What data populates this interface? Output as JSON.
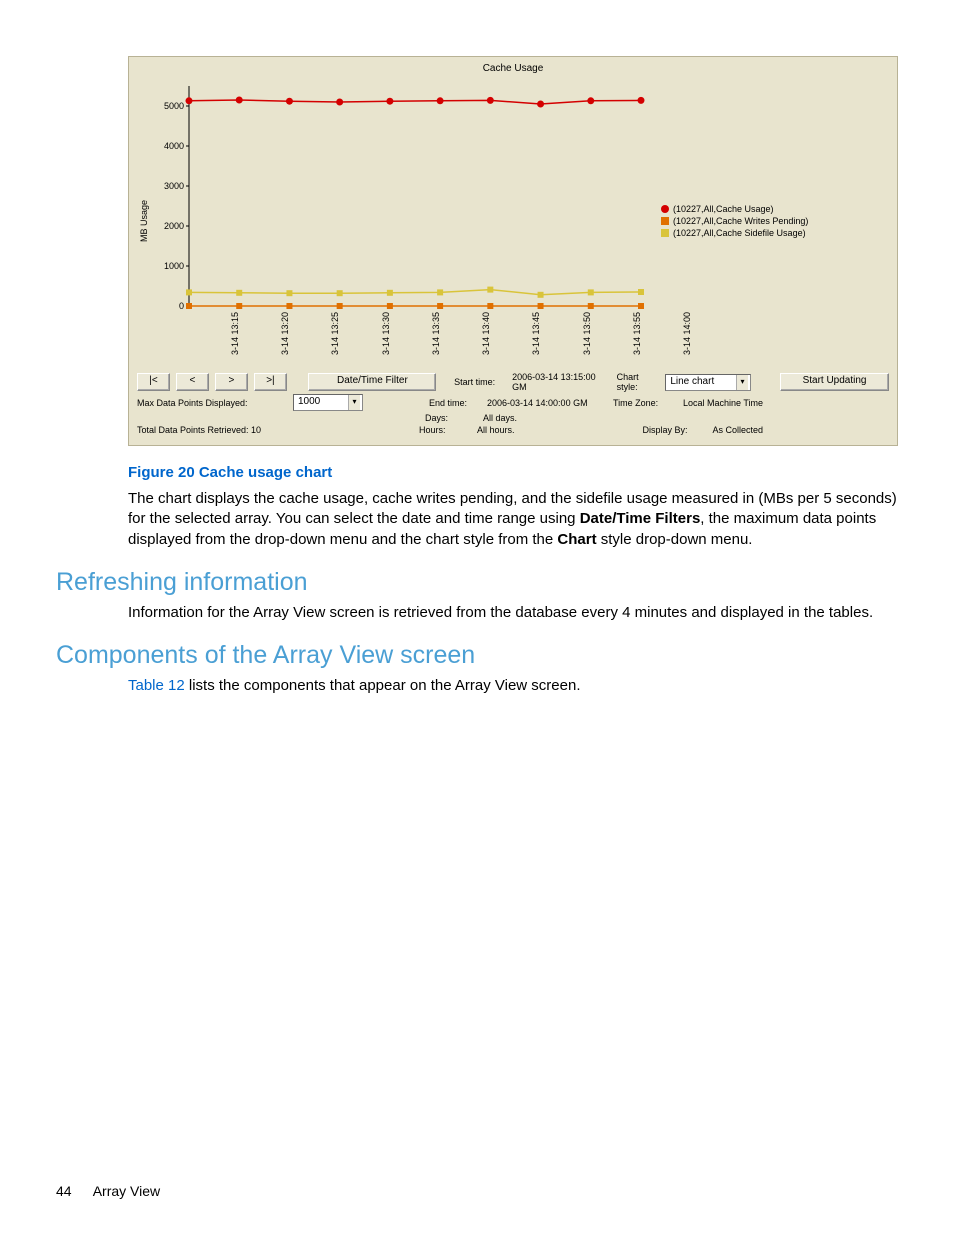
{
  "chart_data": {
    "type": "line",
    "title": "Cache Usage",
    "ylabel": "MB Usage",
    "ylim": [
      0,
      5500
    ],
    "yticks": [
      "0",
      "1000",
      "2000",
      "3000",
      "4000",
      "5000"
    ],
    "categories": [
      "3-14 13:15",
      "3-14 13:20",
      "3-14 13:25",
      "3-14 13:30",
      "3-14 13:35",
      "3-14 13:40",
      "3-14 13:45",
      "3-14 13:50",
      "3-14 13:55",
      "3-14 14:00"
    ],
    "series": [
      {
        "name": "(10227,All,Cache Usage)",
        "color": "#d40000",
        "marker": "circle",
        "values": [
          5130,
          5150,
          5120,
          5100,
          5120,
          5130,
          5140,
          5050,
          5130,
          5140
        ]
      },
      {
        "name": "(10227,All,Cache Writes Pending)",
        "color": "#e07000",
        "marker": "square",
        "values": [
          0,
          0,
          0,
          0,
          0,
          0,
          0,
          0,
          0,
          0
        ]
      },
      {
        "name": "(10227,All,Cache Sidefile Usage)",
        "color": "#d9c43a",
        "marker": "square",
        "values": [
          340,
          330,
          320,
          320,
          330,
          340,
          410,
          280,
          340,
          350
        ]
      }
    ]
  },
  "controls": {
    "nav_first": "|<",
    "nav_prev": "<",
    "nav_next": ">",
    "nav_last": ">|",
    "date_filter_btn": "Date/Time Filter",
    "start_label": "Start time:",
    "start_value": "2006-03-14 13:15:00 GM",
    "end_label": "End time:",
    "end_value": "2006-03-14 14:00:00 GM",
    "chart_style_label": "Chart style:",
    "chart_style_value": "Line chart",
    "start_updating_btn": "Start Updating",
    "max_points_label": "Max Data Points Displayed:",
    "max_points_value": "1000",
    "days_label": "Days:",
    "days_value": "All days.",
    "tz_label": "Time Zone:",
    "tz_value": "Local Machine Time",
    "total_points_label": "Total Data Points Retrieved: 10",
    "hours_label": "Hours:",
    "hours_value": "All hours.",
    "display_by_label": "Display By:",
    "display_by_value": "As Collected"
  },
  "caption": "Figure 20 Cache usage chart",
  "para1_a": "The chart displays the cache usage, cache writes pending, and the sidefile usage measured in (MBs per 5 seconds) for the selected array. You can select the date and time range using ",
  "para1_b": "Date/Time Filters",
  "para1_c": ", the maximum data points displayed from the drop-down menu and the chart style from the ",
  "para1_d": "Chart",
  "para1_e": " style drop-down menu.",
  "h_refresh": "Refreshing information",
  "para_refresh": "Information for the Array View screen is retrieved from the database every 4 minutes and displayed in the tables.",
  "h_components": "Components of the Array View screen",
  "link_table12": "Table 12",
  "para_components": " lists the components that appear on the Array View screen.",
  "footer_page": "44",
  "footer_section": "Array View"
}
